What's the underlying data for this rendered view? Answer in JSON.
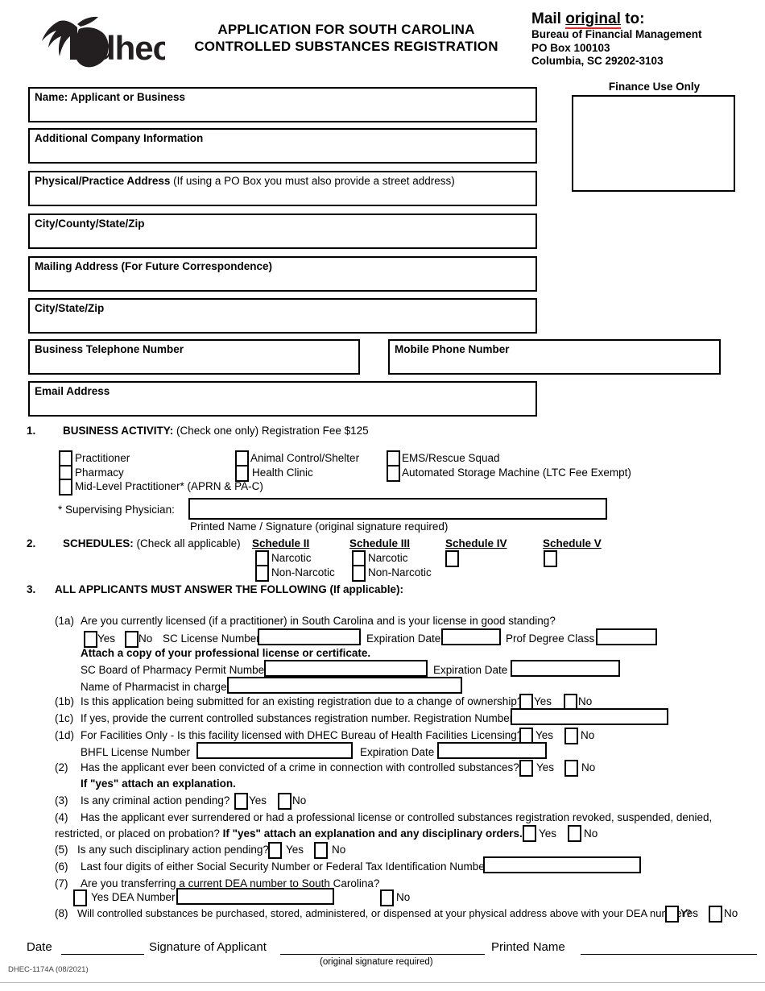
{
  "header": {
    "title_line1": "APPLICATION FOR SOUTH CAROLINA",
    "title_line2": "CONTROLLED SUBSTANCES REGISTRATION",
    "logo_text": "dhec",
    "mail_prefix": "Mail ",
    "mail_emphasis": "original",
    "mail_suffix": " to:",
    "mail_lines": [
      "Bureau of Financial Management",
      "PO Box 100103",
      "Columbia, SC 29202-3103"
    ],
    "finance_label": "Finance Use Only"
  },
  "fields": [
    {
      "label_bold": "Name:  Applicant or Business",
      "label_norm": ""
    },
    {
      "label_bold": "Additional Company Information",
      "label_norm": ""
    },
    {
      "label_bold": "Physical/Practice Address",
      "label_norm": " (If using a PO Box you must also provide a street address)"
    },
    {
      "label_bold": "City/County/State/Zip",
      "label_norm": ""
    },
    {
      "label_bold": "Mailing Address (For Future Correspondence)",
      "label_norm": ""
    },
    {
      "label_bold": "City/State/Zip",
      "label_norm": ""
    },
    {
      "label_bold": "Business Telephone Number",
      "label_norm": ""
    },
    {
      "label_bold": "Mobile Phone Number",
      "label_norm": ""
    },
    {
      "label_bold": "Email Address",
      "label_norm": ""
    }
  ],
  "section1": {
    "number": "1.",
    "heading_bold": "BUSINESS ACTIVITY:",
    "heading_norm": " (Check one only) Registration Fee $125",
    "options_col1": [
      "Practitioner",
      "Pharmacy",
      "Mid-Level Practitioner* (APRN & PA-C)"
    ],
    "options_col2": [
      "Animal Control/Shelter",
      "Health Clinic"
    ],
    "options_col3": [
      "EMS/Rescue Squad",
      "Automated Storage Machine (LTC Fee Exempt)"
    ],
    "supervising_label": "* Supervising Physician:",
    "supervising_value": "",
    "supervising_caption": "Printed Name      /      Signature (original signature required)"
  },
  "section2": {
    "number": "2.",
    "heading_bold": "SCHEDULES:",
    "heading_norm": " (Check all applicable)",
    "schedules": [
      {
        "name": "Schedule II",
        "subs": [
          "Narcotic",
          "Non-Narcotic"
        ]
      },
      {
        "name": "Schedule III",
        "subs": [
          "Narcotic",
          "Non-Narcotic"
        ]
      },
      {
        "name": "Schedule IV",
        "subs": []
      },
      {
        "name": "Schedule V",
        "subs": []
      }
    ]
  },
  "section3": {
    "number": "3.",
    "heading": "ALL APPLICANTS MUST ANSWER THE FOLLOWING (If applicable):",
    "q1a": {
      "tag": "(1a)",
      "text": "Are you currently licensed (if a practitioner) in South Carolina and is your license in good standing?",
      "yes": "Yes",
      "no": "No",
      "sc_license_label": "SC License Number",
      "sc_license_value": "",
      "expiration_label": "Expiration Date",
      "expiration_value": "",
      "degree_label": "Prof Degree Class",
      "degree_value": "",
      "attach_note": "Attach a copy of your professional license or certificate.",
      "pharmacy_permit_label": "SC Board of Pharmacy Permit Number",
      "pharmacy_permit_value": "",
      "permit_exp_label": "Expiration Date",
      "permit_exp_value": "",
      "pharmacist_label": "Name of Pharmacist in charge",
      "pharmacist_value": ""
    },
    "q1b": {
      "tag": "(1b)",
      "text": "Is this application being submitted for an existing registration due to a change of ownership?",
      "yes": "Yes",
      "no": "No"
    },
    "q1c": {
      "tag": "(1c)",
      "text": "If yes, provide the current controlled substances registration number.  Registration Number",
      "value": ""
    },
    "q1d": {
      "tag": "(1d)",
      "text_underline": "For Facilities Only",
      "text_rest": " - Is this facility licensed with DHEC Bureau of Health Facilities Licensing?",
      "yes": "Yes",
      "no": "No",
      "bhfl_label": "BHFL License Number",
      "bhfl_value": "",
      "bhfl_exp_label": "Expiration Date",
      "bhfl_exp_value": ""
    },
    "q2": {
      "tag": "(2)",
      "text": "Has the applicant ever been convicted of a crime in connection with controlled substances?",
      "yes": "Yes",
      "no": "No",
      "note": "If \"yes\" attach an explanation."
    },
    "q3": {
      "tag": "(3)",
      "text": "Is any criminal action pending?",
      "yes": "Yes",
      "no": "No"
    },
    "q4": {
      "tag": "(4)",
      "line1": "Has the applicant ever surrendered or had a professional license or controlled substances registration revoked, suspended, denied,",
      "line2_norm": "restricted, or placed on probation? ",
      "line2_bold": "If \"yes\" attach an explanation and any disciplinary orders.",
      "yes": "Yes",
      "no": "No"
    },
    "q5": {
      "tag": "(5)",
      "text": "Is any such disciplinary action pending?",
      "yes": "Yes",
      "no": "No"
    },
    "q6": {
      "tag": "(6)",
      "text": "Last four digits of either Social Security Number or Federal Tax Identification Number",
      "value": ""
    },
    "q7": {
      "tag": "(7)",
      "text": "Are you transferring a current DEA number to South Carolina?",
      "yes_label": "Yes DEA Number",
      "dea_value": "",
      "no": "No"
    },
    "q8": {
      "tag": "(8)",
      "text": "Will controlled substances be purchased, stored, administered, or dispensed at your physical address above with your DEA number?",
      "yes": "Yes",
      "no": "No"
    }
  },
  "footer": {
    "date_label": "Date",
    "signature_label": "Signature of Applicant",
    "printed_name_label": "Printed Name",
    "signature_caption": "(original signature required)",
    "form_number": "DHEC-1174A (08/2021)"
  },
  "colors": {
    "accent_red": "#e8241f",
    "ink": "#000000",
    "paper": "#ffffff"
  }
}
